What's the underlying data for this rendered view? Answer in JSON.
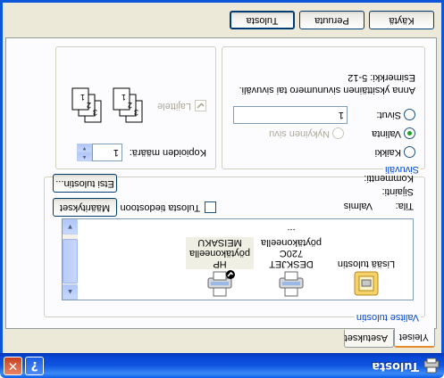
{
  "window": {
    "title": "Tulosta",
    "help_label": "?",
    "close_label": "✕"
  },
  "tabs": [
    {
      "label": "Yleiset"
    },
    {
      "label": "Asetukset"
    }
  ],
  "select_printer": {
    "label": "Valitse tulostin",
    "printers": [
      {
        "name": "Lisää tulostin",
        "icon": "add-printer-icon"
      },
      {
        "name": "DESKJET 720C pöytäkoneella ...",
        "line1": "DESKJET 720C",
        "line2": "pöytäkoneella ...",
        "icon": "printer-icon"
      },
      {
        "name": "HP pöytäkoneella MEISAKU",
        "line1": "HP pöytäkoneella",
        "line2": "MEISAKU",
        "icon": "printer-default-icon"
      }
    ],
    "status_label": "Tila:",
    "status_value": "Valmis",
    "location_label": "Sijainti:",
    "comment_label": "Kommentti:",
    "print_to_file_label": "Tulosta tiedostoon",
    "print_to_file_checked": false,
    "preferences_label": "Määritykset",
    "find_printer_label": "Etsi tulostin..."
  },
  "page_range": {
    "label": "Sivuväli",
    "all_label": "Kaikki",
    "selection_label": "Valinta",
    "current_page_label": "Nykyinen sivu",
    "pages_label": "Sivut:",
    "pages_value": "1",
    "selected": "Valinta",
    "hint_line1": "Anna yksittäinen sivunumero tai sivuväli.",
    "hint_line2": "Esimerkki: 5-12"
  },
  "copies": {
    "count_label": "Kopioiden määrä:",
    "count_value": "1",
    "collate_label": "Lajittele",
    "collate_checked": true,
    "collate_disabled": true,
    "page_numbers": [
      "1",
      "2",
      "3"
    ]
  },
  "buttons": {
    "print": "Tulosta",
    "cancel": "Peruuta",
    "apply": "Käytä"
  },
  "colors": {
    "titlebar": "#0a5ee9",
    "group_label": "#0046d5",
    "dialog_bg": "#ece9d8"
  }
}
